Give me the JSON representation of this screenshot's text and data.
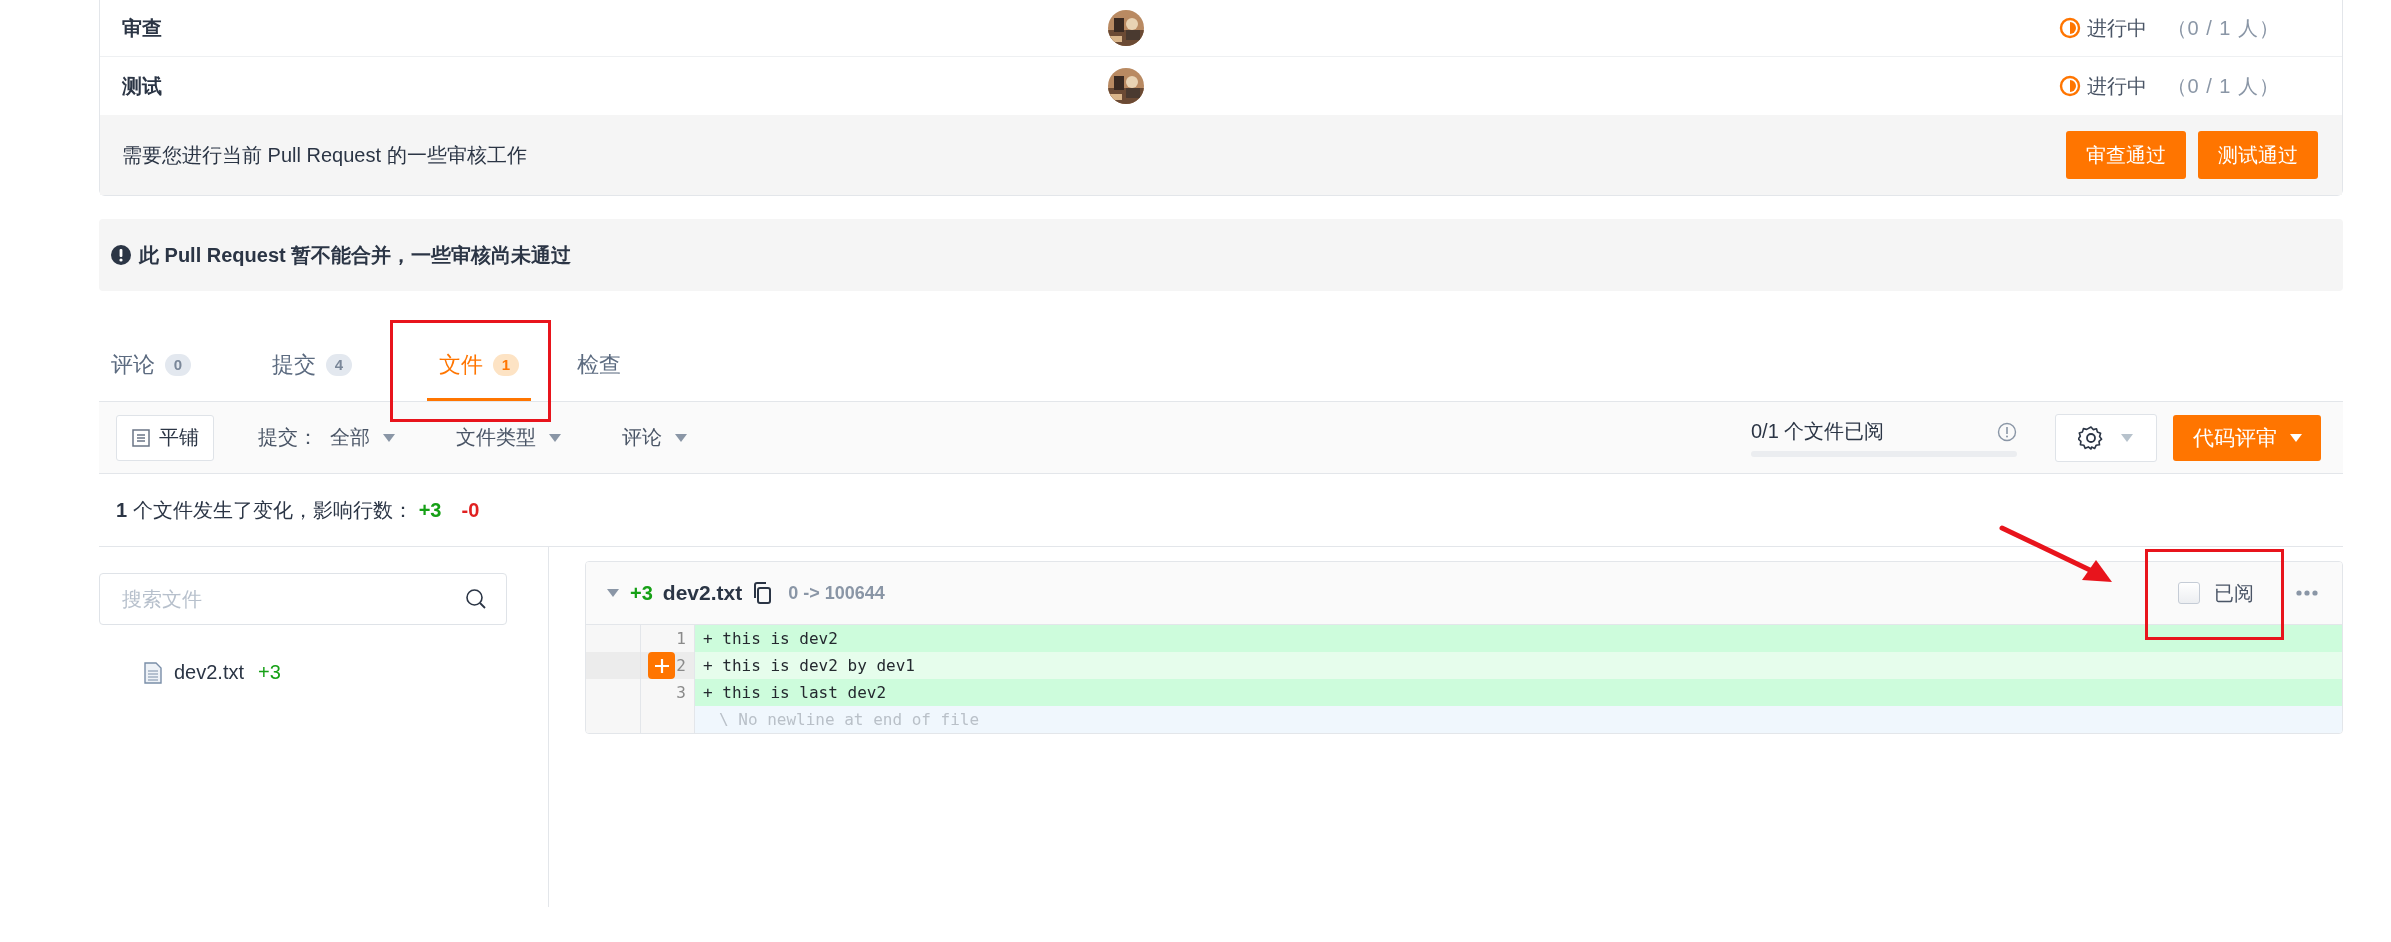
{
  "reviews": {
    "rows": [
      {
        "name": "审查",
        "status": "进行中",
        "count": "（0 / 1 人）"
      },
      {
        "name": "测试",
        "status": "进行中",
        "count": "（0 / 1 人）"
      }
    ],
    "footer_text": "需要您进行当前 Pull Request 的一些审核工作",
    "buttons": [
      "审查通过",
      "测试通过"
    ]
  },
  "merge_notice": "此 Pull Request 暂不能合并，一些审核尚未通过",
  "tabs": [
    {
      "label": "评论",
      "count": "0",
      "selected": false
    },
    {
      "label": "提交",
      "count": "4",
      "selected": false
    },
    {
      "label": "文件",
      "count": "1",
      "selected": true
    },
    {
      "label": "检查",
      "selected": false
    }
  ],
  "toolbar": {
    "layout_button": "平铺",
    "filters": [
      {
        "label": "提交：",
        "value": "全部"
      },
      {
        "label": "文件类型"
      },
      {
        "label": "评论"
      }
    ],
    "progress": {
      "text": "0/1 个文件已阅",
      "level": 0
    },
    "review_button": "代码评审"
  },
  "summary": {
    "count": "1",
    "text": "个文件发生了变化，影响行数：",
    "added": "+3",
    "removed": "-0"
  },
  "sidebar": {
    "search": {
      "placeholder": "搜索文件"
    },
    "files": [
      {
        "name": "dev2.txt",
        "added": "+3"
      }
    ]
  },
  "diff": {
    "added": "+3",
    "filename": "dev2.txt",
    "mode": "0 -> 100644",
    "viewed_label": "已阅",
    "viewed": false,
    "lines": [
      {
        "kind": "add",
        "number": "1",
        "sign": "+",
        "text": "this is dev2",
        "hovered": false
      },
      {
        "kind": "add",
        "number": "2",
        "sign": "+",
        "text": "this is dev2 by dev1",
        "hovered": true
      },
      {
        "kind": "add",
        "number": "3",
        "sign": "+",
        "text": "this is last dev2",
        "hovered": false
      },
      {
        "kind": "note",
        "text": "\\ No newline at end of file"
      }
    ]
  }
}
